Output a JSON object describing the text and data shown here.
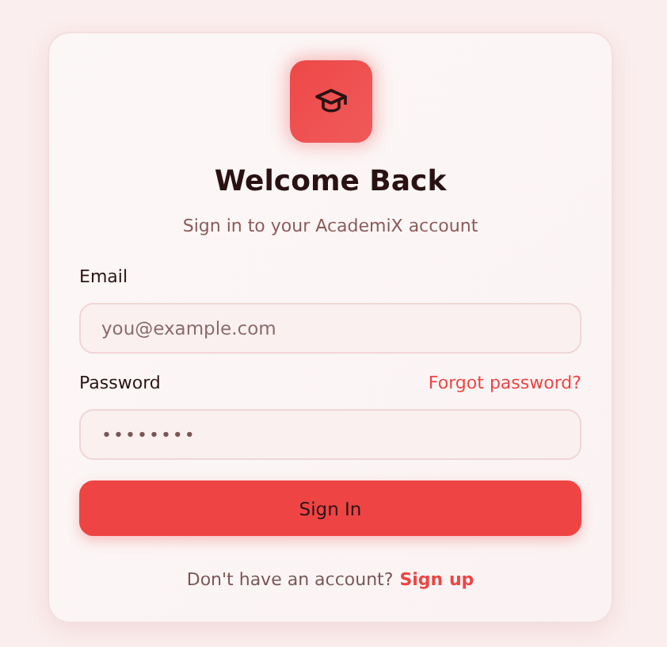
{
  "title": "Welcome Back",
  "subtitle": "Sign in to your AcademiX account",
  "email": {
    "label": "Email",
    "placeholder": "you@example.com"
  },
  "password": {
    "label": "Password",
    "value": "••••••••",
    "forgot_link": "Forgot password?"
  },
  "submit_button": "Sign In",
  "footer": {
    "text": "Don't have an account?",
    "link": "Sign up"
  }
}
